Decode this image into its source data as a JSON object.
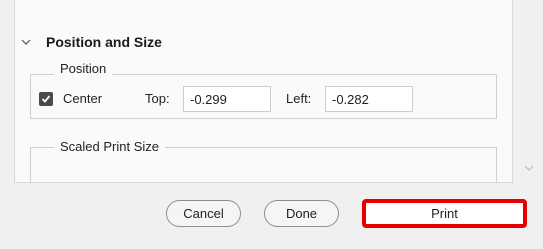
{
  "section": {
    "title": "Position and Size"
  },
  "position_group": {
    "label": "Position",
    "center_label": "Center",
    "center_checked": true,
    "top_label": "Top:",
    "top_value": "-0.299",
    "left_label": "Left:",
    "left_value": "-0.282"
  },
  "scaled_group": {
    "label": "Scaled Print Size"
  },
  "buttons": {
    "cancel": "Cancel",
    "done": "Done",
    "print": "Print"
  },
  "colors": {
    "highlight": "#e60000",
    "checkbox": "#4a4a4a"
  },
  "icons": {
    "section_toggle": "chevron-down-icon",
    "scroll": "chevron-down-icon",
    "check": "checkmark-icon"
  }
}
